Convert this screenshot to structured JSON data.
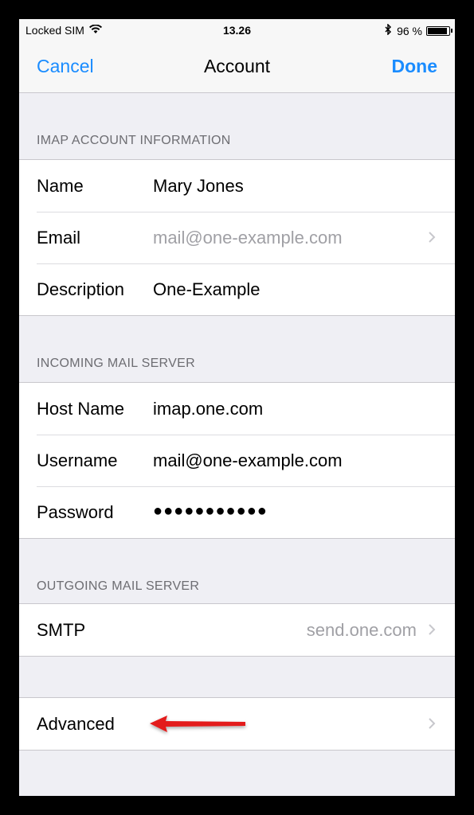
{
  "status_bar": {
    "carrier": "Locked SIM",
    "time": "13.26",
    "battery": "96 %",
    "battery_level": 0.96
  },
  "nav": {
    "cancel": "Cancel",
    "title": "Account",
    "done": "Done"
  },
  "imap_section": {
    "header": "IMAP ACCOUNT INFORMATION",
    "rows": [
      {
        "label": "Name",
        "value": "Mary Jones"
      },
      {
        "label": "Email",
        "value": "mail@one-example.com"
      },
      {
        "label": "Description",
        "value": "One-Example"
      }
    ]
  },
  "incoming_section": {
    "header": "INCOMING MAIL SERVER",
    "rows": [
      {
        "label": "Host Name",
        "value": "imap.one.com"
      },
      {
        "label": "Username",
        "value": "mail@one-example.com"
      },
      {
        "label": "Password",
        "value": "●●●●●●●●●●●"
      }
    ]
  },
  "outgoing_section": {
    "header": "OUTGOING MAIL SERVER",
    "rows": [
      {
        "label": "SMTP",
        "value": "send.one.com"
      }
    ]
  },
  "advanced": {
    "label": "Advanced"
  },
  "colors": {
    "accent": "#1a8cff",
    "arrow": "#e31b1b",
    "background": "#efeff4"
  },
  "icons": [
    "wifi-icon",
    "bluetooth-icon",
    "battery-icon",
    "chevron-right-icon",
    "red-arrow-icon"
  ]
}
